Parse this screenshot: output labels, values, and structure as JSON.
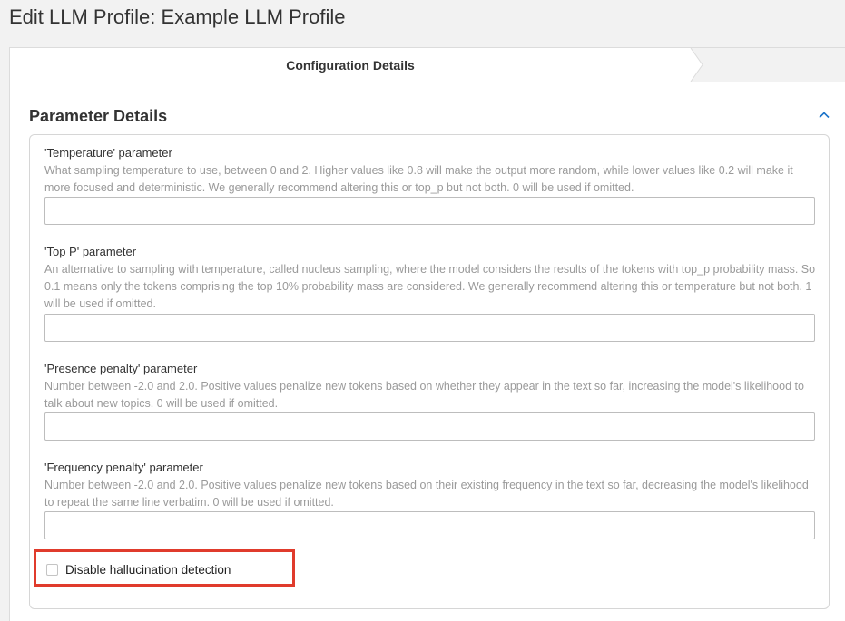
{
  "page": {
    "title": "Edit LLM Profile: Example LLM Profile"
  },
  "steps": {
    "current_label": "Configuration Details"
  },
  "section": {
    "title": "Parameter Details",
    "collapse_icon": "chevron-up-icon"
  },
  "fields": [
    {
      "label": "'Temperature' parameter",
      "help": "What sampling temperature to use, between 0 and 2. Higher values like 0.8 will make the output more random, while lower values like 0.2 will make it more focused and deterministic. We generally recommend altering this or top_p but not both. 0 will be used if omitted.",
      "value": ""
    },
    {
      "label": "'Top P' parameter",
      "help": "An alternative to sampling with temperature, called nucleus sampling, where the model considers the results of the tokens with top_p probability mass. So 0.1 means only the tokens comprising the top 10% probability mass are considered. We generally recommend altering this or temperature but not both. 1 will be used if omitted.",
      "value": ""
    },
    {
      "label": "'Presence penalty' parameter",
      "help": "Number between -2.0 and 2.0. Positive values penalize new tokens based on whether they appear in the text so far, increasing the model's likelihood to talk about new topics. 0 will be used if omitted.",
      "value": ""
    },
    {
      "label": "'Frequency penalty' parameter",
      "help": "Number between -2.0 and 2.0. Positive values penalize new tokens based on their existing frequency in the text so far, decreasing the model's likelihood to repeat the same line verbatim. 0 will be used if omitted.",
      "value": ""
    }
  ],
  "checkbox": {
    "label": "Disable hallucination detection",
    "checked": false
  },
  "colors": {
    "highlight": "#e03b2c",
    "accent": "#1a73c9"
  }
}
